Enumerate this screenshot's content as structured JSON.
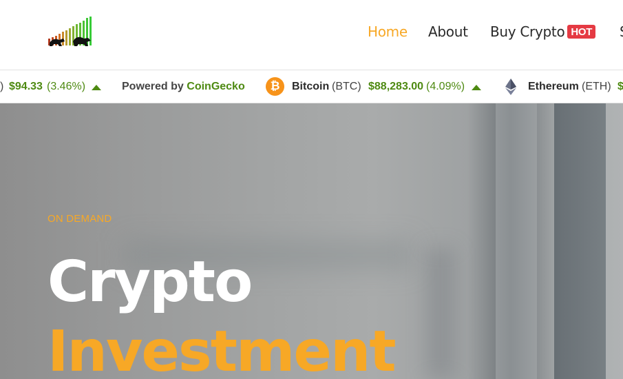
{
  "header": {
    "nav": {
      "home": "Home",
      "about": "About",
      "buy_crypto": "Buy Crypto",
      "hot_badge": "HOT",
      "more": "S"
    }
  },
  "ticker": {
    "prev_price": "$94.33",
    "prev_pct": "(3.46%)",
    "prev_paren": ")",
    "powered_by": "Powered by",
    "powered_brand": "CoinGecko",
    "bitcoin": {
      "name": "Bitcoin",
      "symbol": "(BTC)",
      "price": "$88,283.00",
      "pct": "(4.09%)",
      "icon": "₿"
    },
    "ethereum": {
      "name": "Ethereum",
      "symbol": "(ETH)",
      "price": "$"
    }
  },
  "hero": {
    "eyebrow": "ON DEMAND",
    "title_line1": "Crypto",
    "title_line2": "Investment"
  },
  "colors": {
    "accent": "#f7a826",
    "positive": "#4e8a12",
    "hot": "#e53a43",
    "bitcoin": "#f7931a"
  }
}
